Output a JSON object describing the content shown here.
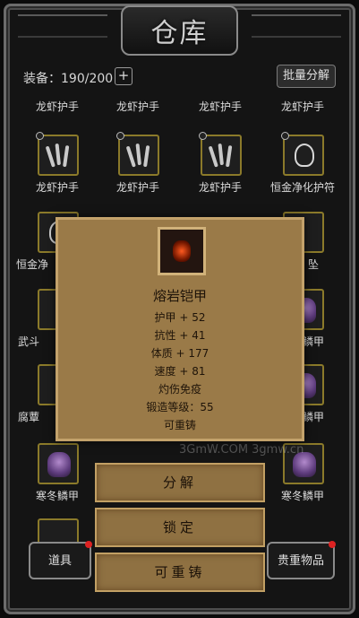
{
  "window": {
    "title": "仓库"
  },
  "header": {
    "capacity": "装备：190/200",
    "add_symbol": "+",
    "batch_button": "批量分解"
  },
  "inventory": {
    "row1": [
      "龙虾护手",
      "龙虾护手",
      "龙虾护手",
      "龙虾护手"
    ],
    "row2": [
      "龙虾护手",
      "龙虾护手",
      "龙虾护手",
      "恒金净化护符"
    ],
    "row3_partial": [
      "恒金净",
      "坠"
    ],
    "row4_partial": [
      "武斗",
      "鳞甲"
    ],
    "row5_partial": [
      "腐蕈",
      "鳞甲"
    ],
    "row6": [
      "寒冬鳞甲",
      "寒冬鳞甲"
    ]
  },
  "tooltip": {
    "name": "熔岩铠甲",
    "stats": [
      "护甲 + 52",
      "抗性 + 41",
      "体质 + 177",
      "速度 + 81",
      "灼伤免疫",
      "锻造等级：55",
      "可重铸"
    ]
  },
  "actions": {
    "decompose": "分解",
    "lock": "锁定",
    "reforge": "可重铸"
  },
  "tabs": {
    "items": "道具",
    "valuables": "贵重物品"
  },
  "watermark": "3GmW.COM  3gmw.cn"
}
